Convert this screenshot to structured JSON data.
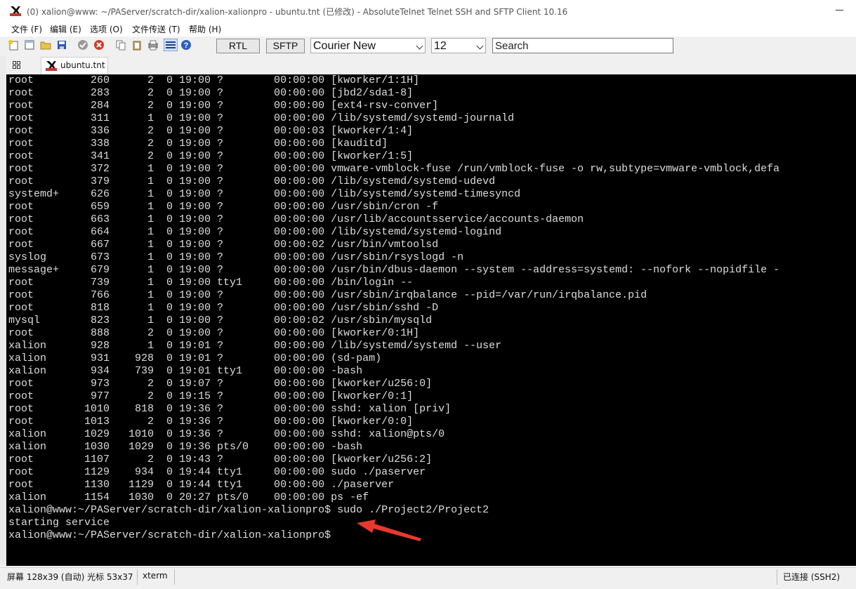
{
  "window": {
    "title": "(0) xalion@www: ~/PAServer/scratch-dir/xalion-xalionpro - ubuntu.tnt (已修改) - AbsoluteTelnet Telnet SSH and SFTP Client 10.16"
  },
  "menu": [
    "文件 (F)",
    "编辑 (E)",
    "选项 (O)",
    "文件传送 (T)",
    "帮助 (H)"
  ],
  "toolbar": {
    "rtl_label": "RTL",
    "sftp_label": "SFTP",
    "font_value": "Courier New",
    "size_value": "12",
    "search_placeholder": "Search"
  },
  "tab": {
    "label": "ubuntu.tnt"
  },
  "terminal": {
    "lines": [
      "root         260      2  0 19:00 ?        00:00:00 [kworker/1:1H]",
      "root         283      2  0 19:00 ?        00:00:00 [jbd2/sda1-8]",
      "root         284      2  0 19:00 ?        00:00:00 [ext4-rsv-conver]",
      "root         311      1  0 19:00 ?        00:00:00 /lib/systemd/systemd-journald",
      "root         336      2  0 19:00 ?        00:00:03 [kworker/1:4]",
      "root         338      2  0 19:00 ?        00:00:00 [kauditd]",
      "root         341      2  0 19:00 ?        00:00:00 [kworker/1:5]",
      "root         372      1  0 19:00 ?        00:00:00 vmware-vmblock-fuse /run/vmblock-fuse -o rw,subtype=vmware-vmblock,defa",
      "root         379      1  0 19:00 ?        00:00:00 /lib/systemd/systemd-udevd",
      "systemd+     626      1  0 19:00 ?        00:00:00 /lib/systemd/systemd-timesyncd",
      "root         659      1  0 19:00 ?        00:00:00 /usr/sbin/cron -f",
      "root         663      1  0 19:00 ?        00:00:00 /usr/lib/accountsservice/accounts-daemon",
      "root         664      1  0 19:00 ?        00:00:00 /lib/systemd/systemd-logind",
      "root         667      1  0 19:00 ?        00:00:02 /usr/bin/vmtoolsd",
      "syslog       673      1  0 19:00 ?        00:00:00 /usr/sbin/rsyslogd -n",
      "message+     679      1  0 19:00 ?        00:00:00 /usr/bin/dbus-daemon --system --address=systemd: --nofork --nopidfile -",
      "root         739      1  0 19:00 tty1     00:00:00 /bin/login --",
      "root         766      1  0 19:00 ?        00:00:00 /usr/sbin/irqbalance --pid=/var/run/irqbalance.pid",
      "root         818      1  0 19:00 ?        00:00:00 /usr/sbin/sshd -D",
      "mysql        823      1  0 19:00 ?        00:00:02 /usr/sbin/mysqld",
      "root         888      2  0 19:00 ?        00:00:00 [kworker/0:1H]",
      "xalion       928      1  0 19:01 ?        00:00:00 /lib/systemd/systemd --user",
      "xalion       931    928  0 19:01 ?        00:00:00 (sd-pam)",
      "xalion       934    739  0 19:01 tty1     00:00:00 -bash",
      "root         973      2  0 19:07 ?        00:00:00 [kworker/u256:0]",
      "root         977      2  0 19:15 ?        00:00:00 [kworker/0:1]",
      "root        1010    818  0 19:36 ?        00:00:00 sshd: xalion [priv]",
      "root        1013      2  0 19:36 ?        00:00:00 [kworker/0:0]",
      "xalion      1029   1010  0 19:36 ?        00:00:00 sshd: xalion@pts/0",
      "xalion      1030   1029  0 19:36 pts/0    00:00:00 -bash",
      "root        1107      2  0 19:43 ?        00:00:00 [kworker/u256:2]",
      "root        1129    934  0 19:44 tty1     00:00:00 sudo ./paserver",
      "root        1130   1129  0 19:44 tty1     00:00:00 ./paserver",
      "xalion      1154   1030  0 20:27 pts/0    00:00:00 ps -ef",
      "xalion@www:~/PAServer/scratch-dir/xalion-xalionpro$ sudo ./Project2/Project2",
      "starting service",
      "xalion@www:~/PAServer/scratch-dir/xalion-xalionpro$"
    ]
  },
  "status": {
    "screen": "屏幕 128x39 (自动) 光标 53x37",
    "emulation": "xterm",
    "connection": "已连接 (SSH2)"
  },
  "annotation": {
    "arrow_color": "#e8392b"
  }
}
